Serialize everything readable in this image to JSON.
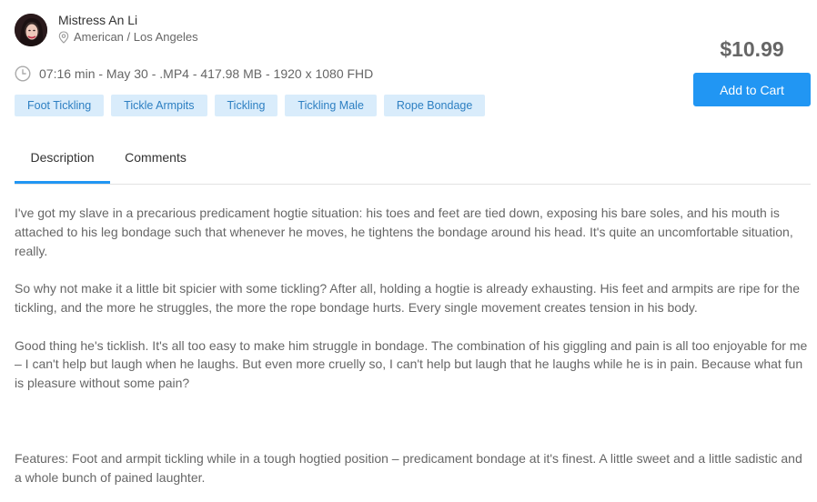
{
  "seller": {
    "name": "Mistress An Li",
    "location": "American / Los Angeles"
  },
  "product": {
    "meta": "07:16 min - May 30 - .MP4 - 417.98 MB - 1920 x 1080 FHD",
    "price": "$10.99",
    "add_to_cart_label": "Add to Cart"
  },
  "tags": [
    "Foot Tickling",
    "Tickle Armpits",
    "Tickling",
    "Tickling Male",
    "Rope Bondage"
  ],
  "tabs": {
    "description": "Description",
    "comments": "Comments"
  },
  "description": {
    "p1": "I've got my slave in a precarious predicament hogtie situation: his toes and feet are tied down, exposing his bare soles, and his mouth is attached to his leg bondage such that whenever he moves, he tightens the bondage around his head. It's quite an uncomfortable situation, really.",
    "p2": "So why not make it a little bit spicier with some tickling? After all, holding a hogtie is already exhausting. His feet and armpits are ripe for the tickling, and the more he struggles, the more the rope bondage hurts. Every single movement creates tension in his body.",
    "p3": "Good thing he's ticklish. It's all too easy to make him struggle in bondage. The combination of his giggling and pain is all too enjoyable for me – I can't help but laugh when he laughs. But even more cruelly so, I can't help but laugh that he laughs while he is in pain. Because what fun is pleasure without some pain?",
    "p4": "Features: Foot and armpit tickling while in a tough hogtied position – predicament bondage at it's finest. A little sweet and a little sadistic and a whole bunch of pained laughter."
  },
  "colors": {
    "accent": "#2196f3",
    "tag_bg": "#d9ecfb",
    "tag_text": "#2d7fc2"
  },
  "icons": {
    "location": "map-pin-icon",
    "duration": "clock-icon"
  }
}
